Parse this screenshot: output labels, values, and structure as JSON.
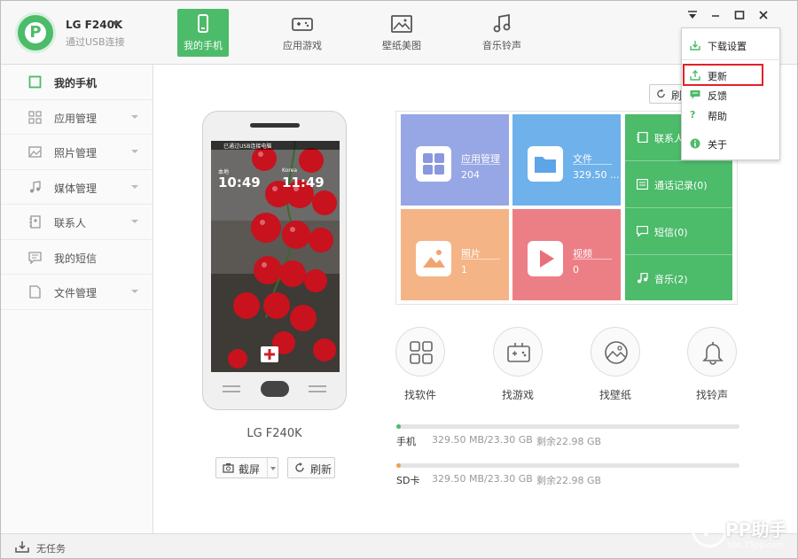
{
  "colors": {
    "accent": "#4cbb6a",
    "tile_apps": "#97a6e4",
    "tile_files": "#6fb1ea",
    "tile_photos": "#f5b486",
    "tile_video": "#ec7f86",
    "tile_green": "#4cbb6a",
    "highlight": "#e3202a"
  },
  "header": {
    "device_name": "LG F240K",
    "connection": "通过USB连接",
    "nav": [
      {
        "label": "我的手机",
        "icon": "phone-icon",
        "active": true
      },
      {
        "label": "应用游戏",
        "icon": "gamepad-icon",
        "active": false
      },
      {
        "label": "壁纸美图",
        "icon": "image-icon",
        "active": false
      },
      {
        "label": "音乐铃声",
        "icon": "music-icon",
        "active": false
      }
    ]
  },
  "sidebar": {
    "items": [
      {
        "label": "我的手机",
        "icon": "square-icon",
        "active": true,
        "has_caret": false
      },
      {
        "label": "应用管理",
        "icon": "grid-icon",
        "has_caret": true
      },
      {
        "label": "照片管理",
        "icon": "photo-icon",
        "has_caret": true
      },
      {
        "label": "媒体管理",
        "icon": "music-note-icon",
        "has_caret": true
      },
      {
        "label": "联系人",
        "icon": "contacts-icon",
        "has_caret": true
      },
      {
        "label": "我的短信",
        "icon": "sms-icon",
        "has_caret": false
      },
      {
        "label": "文件管理",
        "icon": "file-icon",
        "has_caret": true
      }
    ]
  },
  "footer": {
    "tasks_label": "无任务"
  },
  "phone": {
    "model": "LG F240K",
    "screenshot_label": "截屏",
    "refresh_label": "刷新",
    "screen": {
      "status": "已通过USB连接电脑",
      "clock1_city": "本地",
      "clock1_time": "10:49",
      "clock2_city": "Korea",
      "clock2_time": "11:49"
    }
  },
  "tiles": {
    "apps": {
      "title": "应用管理",
      "value": "204"
    },
    "files": {
      "title": "文件",
      "value": "329.50 ..."
    },
    "photos": {
      "title": "照片",
      "value": "1"
    },
    "video": {
      "title": "视频",
      "value": "0"
    },
    "green": [
      {
        "label": "联系人",
        "icon": "contacts-icon"
      },
      {
        "label": "通话记录(0)",
        "icon": "call-log-icon"
      },
      {
        "label": "短信(0)",
        "icon": "sms-icon"
      },
      {
        "label": "音乐(2)",
        "icon": "music-note-icon"
      }
    ]
  },
  "finders": [
    {
      "label": "找软件",
      "icon": "apps-icon"
    },
    {
      "label": "找游戏",
      "icon": "gamepad-icon"
    },
    {
      "label": "找壁纸",
      "icon": "wallpaper-icon"
    },
    {
      "label": "找铃声",
      "icon": "bell-icon"
    }
  ],
  "storage": [
    {
      "name": "手机",
      "used": "329.50 MB/23.30 GB",
      "free": "剩余22.98 GB",
      "fill_fraction": 0.014,
      "color": "#4cbb6a"
    },
    {
      "name": "SD卡",
      "used": "329.50 MB/23.30 GB",
      "free": "剩余22.98 GB",
      "fill_fraction": 0.014,
      "color": "#f0a050"
    }
  ],
  "refresh_top_label": "刷",
  "menu": {
    "items": [
      {
        "label": "下载设置",
        "icon": "download-icon"
      },
      {
        "label": "更新",
        "icon": "upload-icon"
      },
      {
        "label": "反馈",
        "icon": "feedback-icon"
      },
      {
        "label": "帮助",
        "icon": "help-icon"
      },
      {
        "label": "关于",
        "icon": "info-icon"
      }
    ]
  },
  "watermark": {
    "logo": "P",
    "text": "PP助手",
    "url": "bbs.25pp.com"
  }
}
